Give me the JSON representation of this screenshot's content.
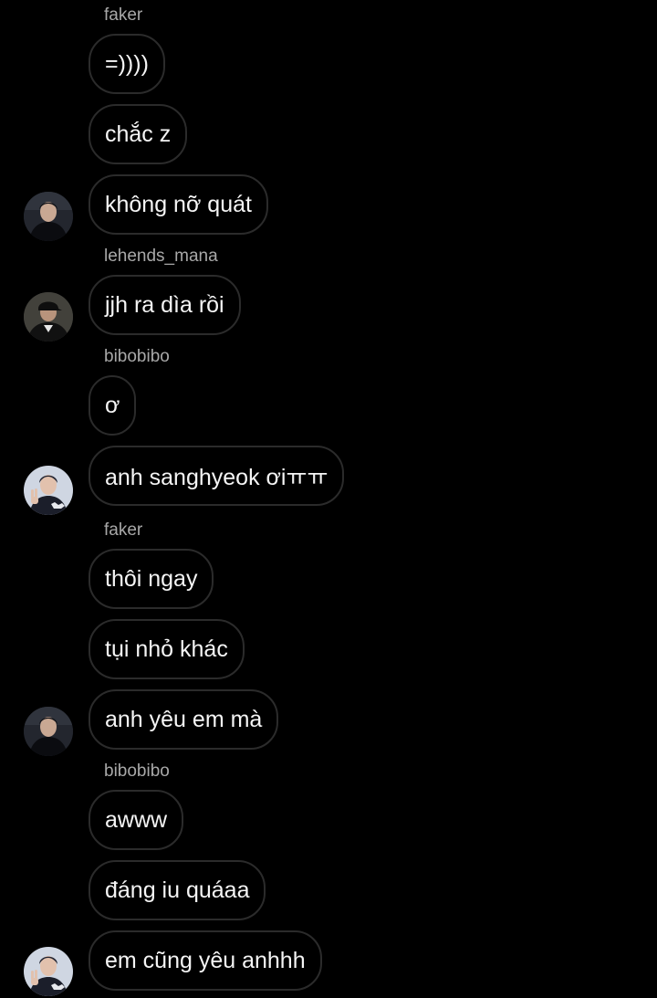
{
  "thread": {
    "groups": [
      {
        "sender": "faker",
        "messages": [
          "=))))",
          "chắc z",
          "không nỡ quát"
        ],
        "avatar": "avatar-dark-hoodie"
      },
      {
        "sender": "lehends_mana",
        "messages": [
          "jjh ra dìa rồi"
        ],
        "avatar": "avatar-cap-man"
      },
      {
        "sender": "bibobibo",
        "messages": [
          "ơ",
          "anh sanghyeok ơiㅠㅠ"
        ],
        "avatar": "avatar-peace-sign"
      },
      {
        "sender": "faker",
        "messages": [
          "thôi ngay",
          "tụi nhỏ khác",
          "anh yêu em mà"
        ],
        "avatar": "avatar-dark-hoodie"
      },
      {
        "sender": "bibobibo",
        "messages": [
          "awww",
          "đáng iu quáaa",
          "em cũng yêu anhhh"
        ],
        "avatar": "avatar-peace-sign"
      }
    ]
  },
  "colors": {
    "background": "#000000",
    "bubble_border": "#2b2b2b",
    "message_text": "#f5f5f5",
    "sender_text": "#a8a8a8"
  }
}
